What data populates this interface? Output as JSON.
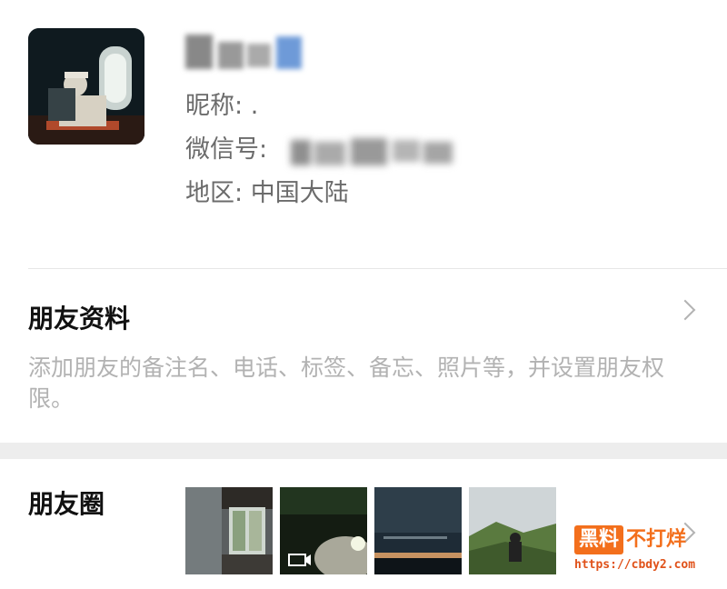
{
  "profile": {
    "nickname_label": "昵称:",
    "nickname_value": ".",
    "wechat_id_label": "微信号:",
    "region_label": "地区:",
    "region_value": "中国大陆"
  },
  "friend_info": {
    "title": "朋友资料",
    "description": "添加朋友的备注名、电话、标签、备忘、照片等，并设置朋友权限。"
  },
  "moments": {
    "title": "朋友圈",
    "thumbnails": [
      {
        "name": "room-window-photo"
      },
      {
        "name": "night-rocks-video",
        "icon": "video-icon"
      },
      {
        "name": "dusk-sky-photo"
      },
      {
        "name": "mountain-hiker-photo"
      }
    ]
  },
  "watermark": {
    "badge": "黑料",
    "text": "不打烊",
    "url": "https://cbdy2.com"
  }
}
